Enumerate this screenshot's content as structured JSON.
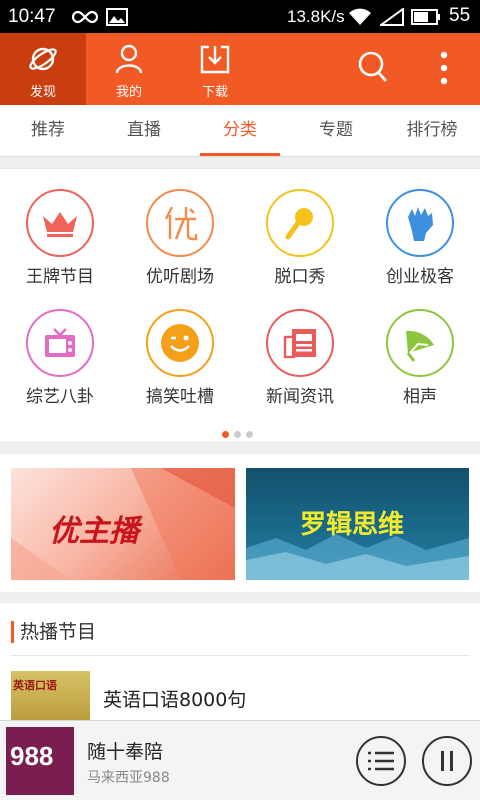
{
  "status_bar": {
    "time": "10:47",
    "net_speed": "13.8K/s",
    "battery": "55"
  },
  "nav": {
    "items": [
      {
        "label": "发现",
        "icon": "planet-icon"
      },
      {
        "label": "我的",
        "icon": "user-icon"
      },
      {
        "label": "下载",
        "icon": "download-icon"
      }
    ],
    "active_index": 0
  },
  "tabs": [
    "推荐",
    "直播",
    "分类",
    "专题",
    "排行榜"
  ],
  "active_tab": "分类",
  "categories": [
    {
      "label": "王牌节目",
      "icon": "crown-icon",
      "color": "#f0635a"
    },
    {
      "label": "优听剧场",
      "icon": "you-char-icon",
      "color": "#f28b4b"
    },
    {
      "label": "脱口秀",
      "icon": "microphone-icon",
      "color": "#f4c21b"
    },
    {
      "label": "创业极客",
      "icon": "fist-icon",
      "color": "#3d8fe0"
    },
    {
      "label": "综艺八卦",
      "icon": "tv-icon",
      "color": "#e46bc4"
    },
    {
      "label": "搞笑吐槽",
      "icon": "smile-icon",
      "color": "#f5a01a"
    },
    {
      "label": "新闻资讯",
      "icon": "newspaper-icon",
      "color": "#ec5b5b"
    },
    {
      "label": "相声",
      "icon": "fan-icon",
      "color": "#8cc63f"
    }
  ],
  "page_dots": {
    "count": 3,
    "active": 0
  },
  "banners": [
    {
      "text": "优主播"
    },
    {
      "text": "罗辑思维"
    }
  ],
  "hot": {
    "section_title": "热播节目",
    "items": [
      {
        "title": "英语口语8000句",
        "thumb_text": "英语口语"
      }
    ]
  },
  "player": {
    "title": "随十奉陪",
    "station": "马来西亚988",
    "cover_text": "988"
  },
  "colors": {
    "accent": "#f15a24",
    "accent_dark": "#c93d0e"
  }
}
